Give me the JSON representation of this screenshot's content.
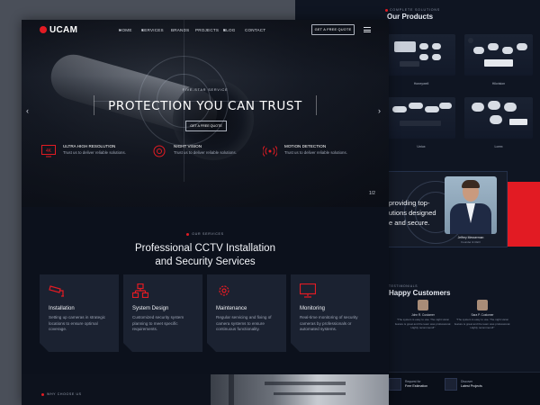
{
  "brand": {
    "name": "UCAM",
    "accent": "#e21b23"
  },
  "nav": {
    "items": [
      "HOME",
      "SERVICES",
      "BRANDS",
      "PROJECTS",
      "BLOG",
      "CONTACT"
    ],
    "cta": "GET A FREE QUOTE"
  },
  "hero": {
    "kicker": "FIVE-STAR SERVICE",
    "headline": "PROTECTION YOU CAN TRUST",
    "button": "GET A FREE QUOTE",
    "pager": "1/2",
    "features": [
      {
        "title": "ULTRA HIGH RESOLUTION",
        "desc": "Trust us to deliver reliable solutions.",
        "icon": "4k-monitor-icon"
      },
      {
        "title": "NIGHT VISION",
        "desc": "Trust us to deliver reliable solutions.",
        "icon": "night-vision-icon"
      },
      {
        "title": "MOTION DETECTION",
        "desc": "Trust us to deliver reliable solutions.",
        "icon": "motion-sensor-icon"
      }
    ]
  },
  "services": {
    "kicker": "OUR SERVICES",
    "title_line1": "Professional CCTV Installation",
    "title_line2": "and Security Services",
    "cards": [
      {
        "title": "Installation",
        "desc": "Setting up cameras in strategic locations to ensure optimal coverage.",
        "icon": "cctv-camera-icon"
      },
      {
        "title": "System Design",
        "desc": "Customized security system planning to meet specific requirements.",
        "icon": "network-diagram-icon"
      },
      {
        "title": "Maintenance",
        "desc": "Regular servicing and fixing of camera systems to ensure continuous functionality.",
        "icon": "gear-icon"
      },
      {
        "title": "Monitoring",
        "desc": "Real-time monitoring of security cameras by professionals or automated systems.",
        "icon": "monitor-icon"
      }
    ]
  },
  "why": {
    "kicker": "WHY CHOOSE US"
  },
  "side": {
    "kicker": "COMPLETE SOLUTIONS",
    "title": "Our Products",
    "products": [
      "Honeywell",
      "Hikvision",
      "Uniux",
      "Lorex"
    ],
    "video_text_l1": "providing top-",
    "video_text_l2": "utions designed",
    "video_text_l3": "e and secure.",
    "person_name": "Jeffrey Messerman",
    "person_role": "Founder & CEO",
    "testi_kicker": "TESTIMONIALS",
    "testi_title": "Happy Customers",
    "testimonials": [
      {
        "name": "John R. Customer",
        "text": "\"The system is easy to use. The night vision feature is great and the team was professional. Highly recommend!\""
      },
      {
        "name": "Sara P. Customer",
        "text": "\"The system is easy to use. The night vision feature is great and the team was professional. Highly recommend!\""
      }
    ],
    "footer": [
      {
        "t1": "Request for",
        "t2": "Free Estimation"
      },
      {
        "t1": "Discover",
        "t2": "Latest Projects"
      }
    ]
  }
}
